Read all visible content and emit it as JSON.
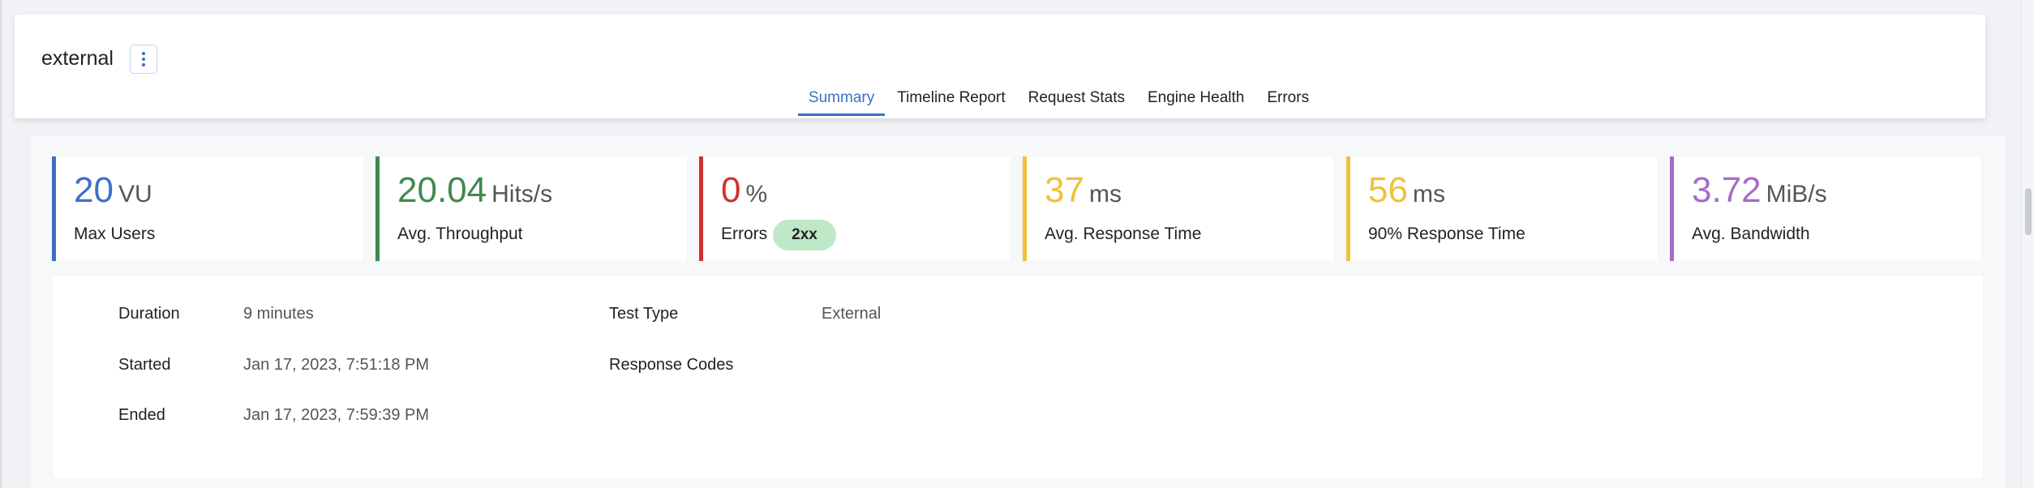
{
  "header": {
    "title": "external",
    "tabs": [
      {
        "label": "Summary",
        "active": true
      },
      {
        "label": "Timeline Report",
        "active": false
      },
      {
        "label": "Request Stats",
        "active": false
      },
      {
        "label": "Engine Health",
        "active": false
      },
      {
        "label": "Errors",
        "active": false
      }
    ]
  },
  "stats": [
    {
      "value": "20",
      "unit": "VU",
      "label": "Max Users",
      "color": "#3d6fc6"
    },
    {
      "value": "20.04",
      "unit": "Hits/s",
      "label": "Avg. Throughput",
      "color": "#3f8a4f"
    },
    {
      "value": "0",
      "unit": "%",
      "label": "Errors",
      "color": "#d0302f"
    },
    {
      "value": "37",
      "unit": "ms",
      "label": "Avg. Response Time",
      "color": "#f0c13a"
    },
    {
      "value": "56",
      "unit": "ms",
      "label": "90% Response Time",
      "color": "#f0c13a"
    },
    {
      "value": "3.72",
      "unit": "MiB/s",
      "label": "Avg. Bandwidth",
      "color": "#a66cc6"
    }
  ],
  "details": {
    "duration_label": "Duration",
    "duration_value": "9 minutes",
    "started_label": "Started",
    "started_value": "Jan 17, 2023, 7:51:18 PM",
    "ended_label": "Ended",
    "ended_value": "Jan 17, 2023, 7:59:39 PM",
    "test_type_label": "Test Type",
    "test_type_value": "External",
    "response_codes_label": "Response Codes",
    "response_codes": [
      "2xx"
    ]
  },
  "colors": {
    "accent": "#3d6fc6",
    "badge_success": "#bfe8c8"
  }
}
